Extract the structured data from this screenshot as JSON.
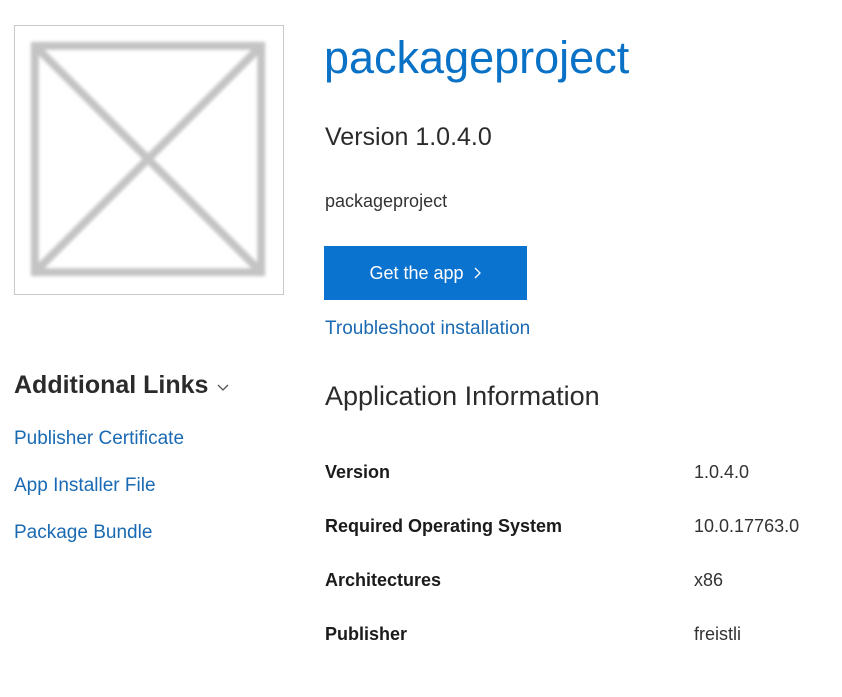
{
  "app": {
    "title": "packageproject",
    "version_heading": "Version 1.0.4.0",
    "description": "packageproject",
    "get_app_label": "Get the app",
    "troubleshoot_label": "Troubleshoot installation"
  },
  "logo": {
    "icon": "placeholder-image-icon"
  },
  "additional_links": {
    "title": "Additional Links",
    "items": [
      {
        "label": "Publisher Certificate"
      },
      {
        "label": "App Installer File"
      },
      {
        "label": "Package Bundle"
      }
    ]
  },
  "app_info": {
    "heading": "Application Information",
    "rows": [
      {
        "key": "Version",
        "value": "1.0.4.0"
      },
      {
        "key": "Required Operating System",
        "value": "10.0.17763.0"
      },
      {
        "key": "Architectures",
        "value": "x86"
      },
      {
        "key": "Publisher",
        "value": "freistli"
      }
    ]
  },
  "colors": {
    "accent": "#0a72cf",
    "link": "#1a6ab3",
    "title": "#0a72c6"
  }
}
